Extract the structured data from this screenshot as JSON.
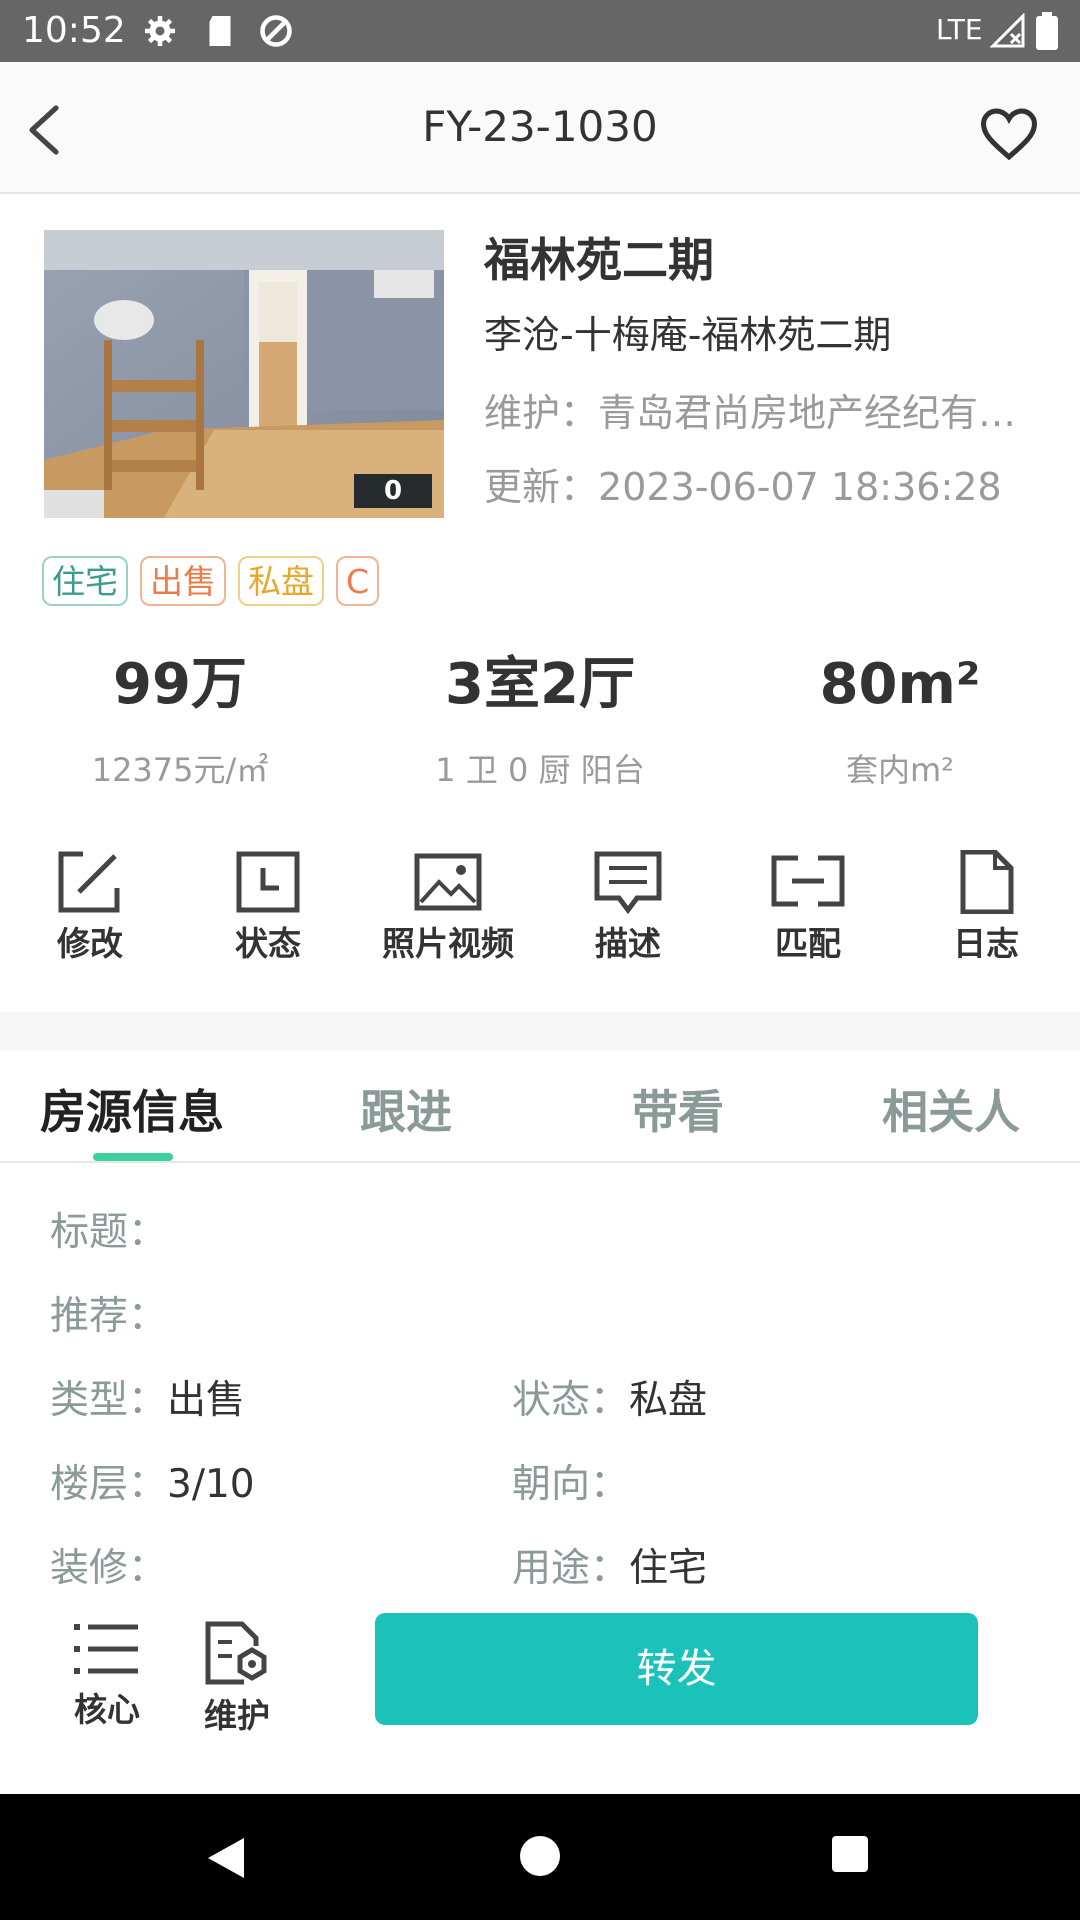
{
  "status_bar": {
    "time": "10:52",
    "network": "LTE"
  },
  "header": {
    "title": "FY-23-1030"
  },
  "property": {
    "photo_count": "0",
    "name": "福林苑二期",
    "location": "李沧-十梅庵-福林苑二期",
    "maintenance_label": "维护：",
    "maintenance_value": "青岛君尚房地产经纪有…",
    "update_label": "更新：",
    "update_value": "2023-06-07 18:36:28",
    "tags": [
      "住宅",
      "出售",
      "私盘",
      "C"
    ]
  },
  "stats": [
    {
      "value": "99万",
      "sub": "12375元/㎡"
    },
    {
      "value": "3室2厅",
      "sub": "1 卫 0 厨  阳台"
    },
    {
      "value": "80m²",
      "sub": "套内m²"
    }
  ],
  "actions": [
    "修改",
    "状态",
    "照片视频",
    "描述",
    "匹配",
    "日志"
  ],
  "tabs": [
    "房源信息",
    "跟进",
    "带看",
    "相关人"
  ],
  "info": {
    "title_label": "标题：",
    "title_value": "",
    "recommend_label": "推荐：",
    "recommend_value": "",
    "type_label": "类型：",
    "type_value": "出售",
    "status_label": "状态：",
    "status_value": "私盘",
    "floor_label": "楼层：",
    "floor_value": "3/10",
    "orientation_label": "朝向：",
    "orientation_value": "",
    "decoration_label": "装修：",
    "decoration_value": "",
    "usage_label": "用途：",
    "usage_value": "住宅"
  },
  "bottom": {
    "core_label": "核心",
    "maintain_label": "维护",
    "forward_label": "转发"
  },
  "colors": {
    "accent": "#1bc2b9",
    "tab_indicator": "#3ad29a",
    "status_bar": "#666666"
  }
}
